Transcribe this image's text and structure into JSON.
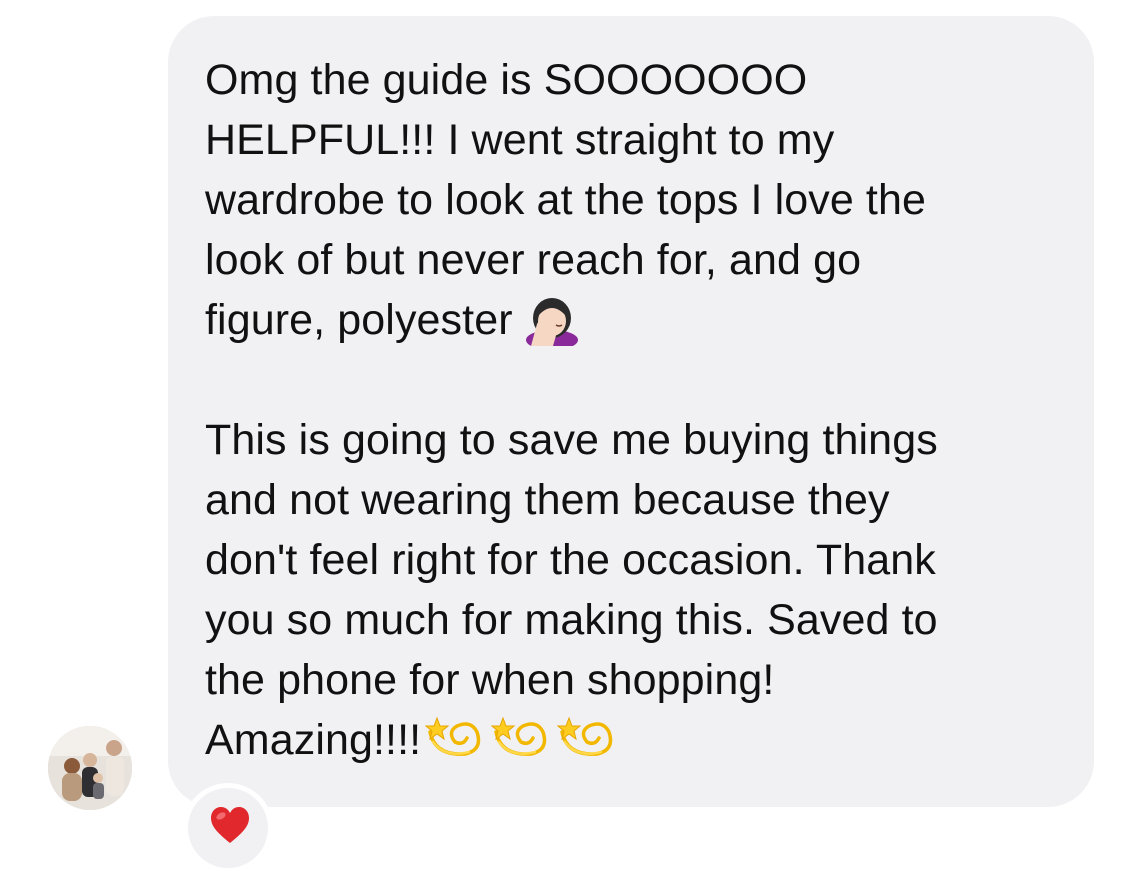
{
  "message": {
    "paragraph1": "Omg the guide is SOOOOOOO\nHELPFUL!!! I went straight to my\nwardrobe to look at the tops I love the\nlook of but never reach for, and go\nfigure, polyester",
    "paragraph2": "This is going to save me buying things\nand not wearing them because they\ndon't feel right for the occasion. Thank\nyou so much for making this. Saved to\nthe phone for when shopping!\nAmazing!!!!",
    "emoji_after_p1": "face-palm-emoji",
    "emojis_after_p2": [
      "dizzy-emoji",
      "dizzy-emoji",
      "dizzy-emoji"
    ]
  },
  "reaction": {
    "icon": "heart-emoji",
    "color": "#e0282d"
  },
  "avatar": {
    "icon": "profile-photo"
  },
  "colors": {
    "bubble": "#f1f1f4",
    "text": "#111111",
    "background": "#ffffff"
  }
}
